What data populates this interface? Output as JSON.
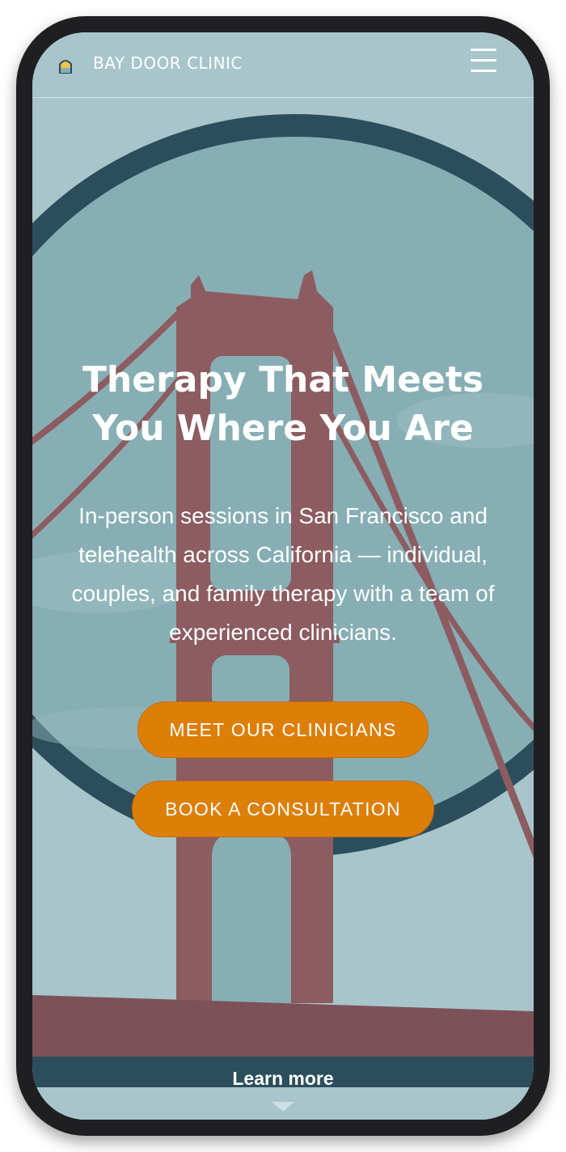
{
  "nav": {
    "brand": "BAY DOOR CLINIC",
    "logo_icon": "sunset-door-logo-icon",
    "menu_icon": "hamburger-menu-icon"
  },
  "hero": {
    "title_line1": "Therapy That Meets",
    "title_line2": "You Where You Are",
    "description": "In-person sessions in San Francisco and telehealth across California — individual, couples, and family therapy with a team of experienced clinicians.",
    "primary_cta": "MEET OUR CLINICIANS",
    "secondary_cta": "BOOK A CONSULTATION",
    "learn_more": "Learn more",
    "scroll_icon": "chevron-down-icon"
  },
  "colors": {
    "sky": "#a7c5ca",
    "circle": "#87aeb5",
    "ring": "#2c4e5c",
    "bridge": "#8c5c61",
    "button": "#dd7f06",
    "text": "#ffffff"
  }
}
